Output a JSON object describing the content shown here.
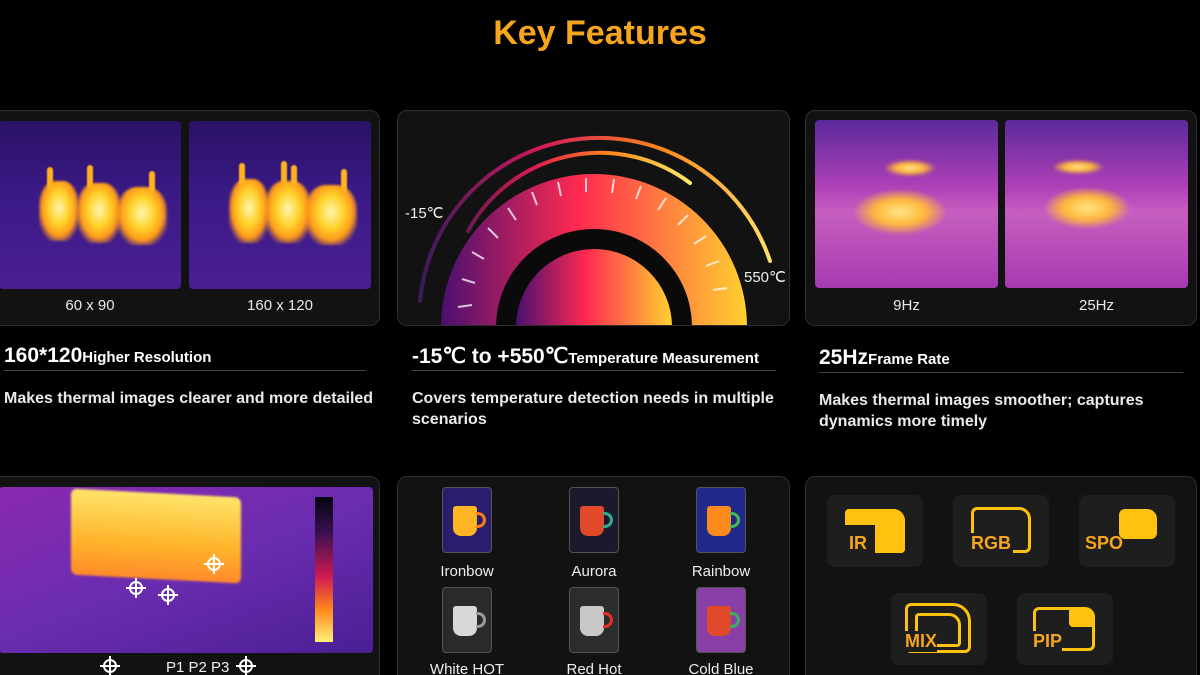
{
  "title": "Key Features",
  "resolution": {
    "captions": [
      "60 x 90",
      "160 x 120"
    ],
    "title_big": "160*120",
    "title_small": "Higher Resolution",
    "description": "Makes thermal images clearer and more detailed"
  },
  "temperature": {
    "min_label": "-15℃",
    "max_label": "550℃",
    "title_big": "-15℃ to +550℃",
    "title_small": "Temperature Measurement",
    "description": "Covers temperature detection needs in multiple scenarios"
  },
  "framerate": {
    "captions": [
      "9Hz",
      "25Hz"
    ],
    "title_big": "25Hz",
    "title_small": "Frame Rate",
    "description": "Makes thermal images smoother; captures dynamics more timely"
  },
  "points": {
    "labels": "P1 P2 P3"
  },
  "palettes": [
    {
      "name": "Ironbow",
      "bg": "#2b1d6e",
      "cup": "#ffb424",
      "handle": "#ff7a1a"
    },
    {
      "name": "Aurora",
      "bg": "#1a1a2c",
      "cup": "#e0492a",
      "handle": "#2fae8c"
    },
    {
      "name": "Rainbow",
      "bg": "#1f2a8a",
      "cup": "#ff8a1c",
      "handle": "#3fb850"
    },
    {
      "name": "White HOT",
      "bg": "#2a2a2a",
      "cup": "#d8d8d8",
      "handle": "#9a9a9a"
    },
    {
      "name": "Red Hot",
      "bg": "#2c2c2c",
      "cup": "#c8c8c8",
      "handle": "#e23030"
    },
    {
      "name": "Cold Blue",
      "bg": "#8a3fa8",
      "cup": "#e04a2a",
      "handle": "#3ab05a"
    }
  ],
  "modes": [
    "IR",
    "RGB",
    "SPO",
    "MIX",
    "PIP"
  ],
  "colors": {
    "accent": "#f7a51c",
    "mode_yellow": "#ffc20e"
  }
}
